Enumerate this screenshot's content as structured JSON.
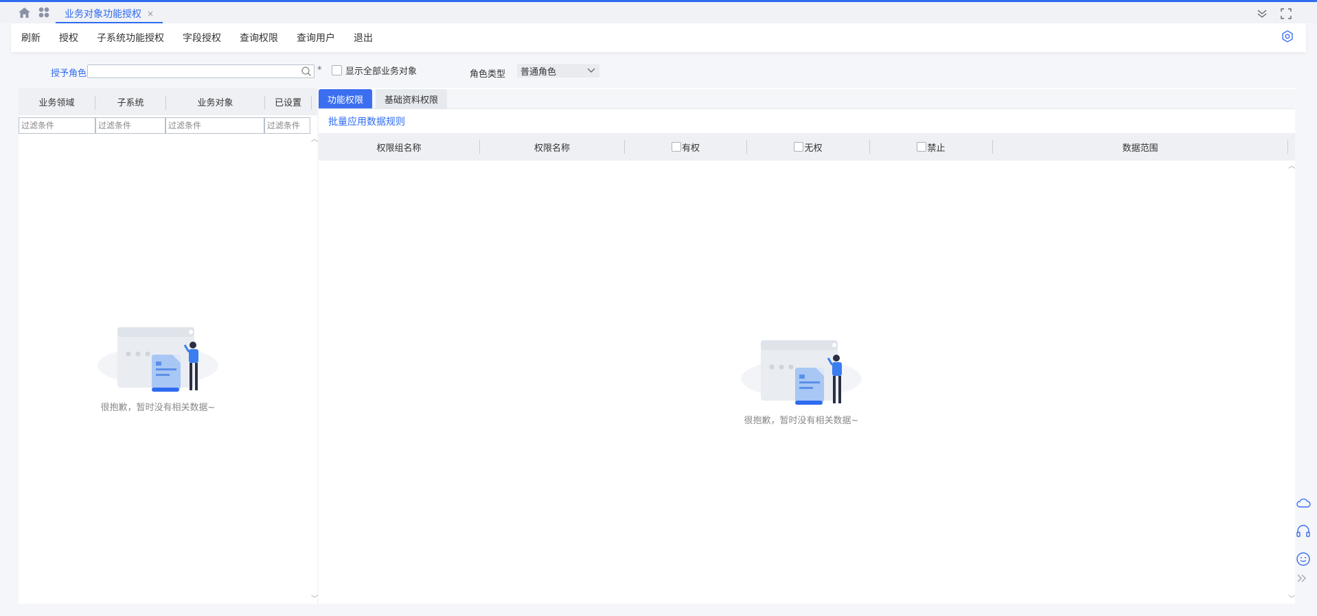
{
  "tabbar": {
    "icons": [
      "home-icon",
      "apps-grid-icon"
    ],
    "active_tab": {
      "label": "业务对象功能授权",
      "close": "×"
    },
    "right_icons": [
      "collapse-chevrons-icon",
      "fullscreen-icon"
    ]
  },
  "toolbar": {
    "buttons": [
      "刷新",
      "授权",
      "子系统功能授权",
      "字段授权",
      "查询权限",
      "查询用户",
      "退出"
    ],
    "settings_icon": "gear-icon"
  },
  "filter": {
    "role_label": "授予角色",
    "role_value": "",
    "required_mark": "*",
    "show_all_label": "显示全部业务对象",
    "show_all_checked": false,
    "role_type_label": "角色类型",
    "role_type_value": "普通角色"
  },
  "left_table": {
    "columns": [
      "业务领域",
      "子系统",
      "业务对象",
      "已设置"
    ],
    "filter_placeholder": "过滤条件",
    "empty_text": "很抱歉，暂时没有相关数据~"
  },
  "right": {
    "tabs": [
      "功能权限",
      "基础资料权限"
    ],
    "active_tab": 0,
    "batch_link": "批量应用数据规则",
    "columns": [
      "权限组名称",
      "权限名称",
      "有权",
      "无权",
      "禁止",
      "数据范围"
    ],
    "empty_text": "很抱歉，暂时没有相关数据~"
  },
  "side_icons": [
    "cloud-icon",
    "headset-icon",
    "smiley-icon",
    "double-chevron-right-icon"
  ],
  "colors": {
    "accent": "#2e6bf0",
    "header_bg": "#eef0f4",
    "page_bg": "#f5f6f9"
  }
}
